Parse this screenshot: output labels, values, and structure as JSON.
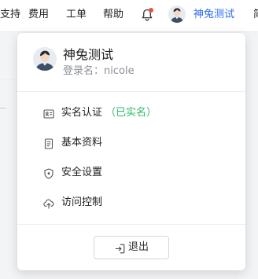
{
  "topbar": {
    "nav": [
      {
        "label": "支持",
        "name": "nav-support"
      },
      {
        "label": "费用",
        "name": "nav-billing"
      },
      {
        "label": "工单",
        "name": "nav-tickets"
      },
      {
        "label": "帮助",
        "name": "nav-help"
      }
    ],
    "notification_icon": "bell-icon",
    "notification_dot_color": "#f04c3e",
    "user_name": "神兔测试",
    "truncated_next": "简",
    "accent_color": "#2b6df0"
  },
  "dropdown": {
    "profile": {
      "avatar_icon": "avatar",
      "name": "神兔测试",
      "login_label": "登录名：",
      "login_value": "nicole"
    },
    "menu": [
      {
        "icon": "id-card-icon",
        "label": "实名认证",
        "badge": "（已实名）",
        "badge_color": "#2fb867"
      },
      {
        "icon": "document-icon",
        "label": "基本资料",
        "badge": ""
      },
      {
        "icon": "shield-icon",
        "label": "安全设置",
        "badge": ""
      },
      {
        "icon": "cloud-upload-icon",
        "label": "访问控制",
        "badge": ""
      }
    ],
    "logout": {
      "icon": "logout-icon",
      "label": "退出"
    }
  }
}
